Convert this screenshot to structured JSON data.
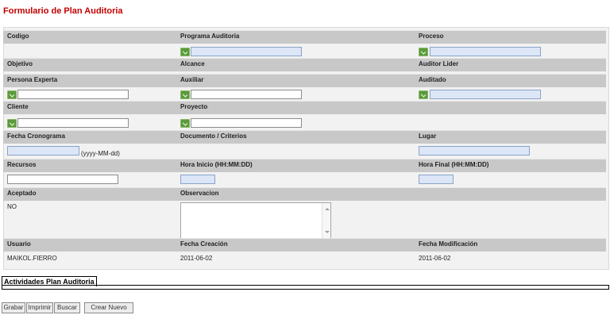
{
  "title": "Formulario de Plan Auditoria",
  "labels": {
    "codigo": "Codigo",
    "programa": "Programa Auditoria",
    "proceso": "Proceso",
    "objetivo": "Objetivo",
    "alcance": "Alcance",
    "auditor_lider": "Auditor Lider",
    "persona_experta": "Persona Experta",
    "auxiliar": "Auxiliar",
    "auditado": "Auditado",
    "cliente": "Cliente",
    "proyecto": "Proyecto",
    "fecha_cronograma": "Fecha Cronograma",
    "documento": "Documento / Criterios",
    "lugar": "Lugar",
    "recursos": "Recursos",
    "hora_inicio": "Hora Inicio (HH:MM:DD)",
    "hora_final": "Hora Final (HH:MM:DD)",
    "aceptado": "Aceptado",
    "observacion": "Observacion",
    "usuario": "Usuario",
    "fecha_creacion": "Fecha Creación",
    "fecha_modificacion": "Fecha Modificación"
  },
  "date_hint": "(yyyy-MM-dd)",
  "values": {
    "aceptado": "NO",
    "usuario": "MAIKOL.FIERRO",
    "fecha_creacion": "2011-06-02",
    "fecha_modificacion": "2011-06-02"
  },
  "section_title": "Actividades Plan Auditoria",
  "buttons": {
    "grabar": "Grabar",
    "imprimir": "Imprimir",
    "buscar": "Buscar",
    "crear_nuevo": "Crear Nuevo"
  }
}
